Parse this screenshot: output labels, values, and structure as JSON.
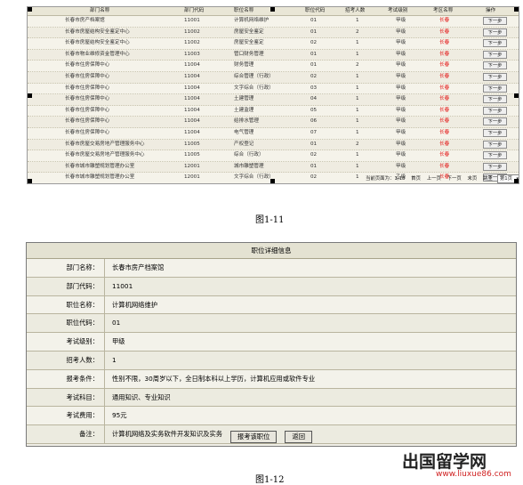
{
  "figure_1_11": {
    "caption": "图1-11",
    "headers": [
      "部门名称",
      "部门代码",
      "职位名称",
      "职位代码",
      "招考人数",
      "考试级别",
      "考区名称",
      "操作"
    ],
    "rows": [
      [
        "长春市房产档案馆",
        "11001",
        "计算机网络维护",
        "01",
        "1",
        "甲级",
        "长春",
        "下一步"
      ],
      [
        "长春市房屋结构安全鉴定中心",
        "11002",
        "房屋安全鉴定",
        "01",
        "2",
        "甲级",
        "长春",
        "下一步"
      ],
      [
        "长春市房屋结构安全鉴定中心",
        "11002",
        "房屋安全鉴定",
        "02",
        "1",
        "甲级",
        "长春",
        "下一步"
      ],
      [
        "长春市物业维修资金管理中心",
        "11003",
        "管口财务管理",
        "01",
        "1",
        "甲级",
        "长春",
        "下一步"
      ],
      [
        "长春市住房保障中心",
        "11004",
        "财务管理",
        "01",
        "2",
        "甲级",
        "长春",
        "下一步"
      ],
      [
        "长春市住房保障中心",
        "11004",
        "综合管理（行政）",
        "02",
        "1",
        "甲级",
        "长春",
        "下一步"
      ],
      [
        "长春市住房保障中心",
        "11004",
        "文字综合（行政）",
        "03",
        "1",
        "甲级",
        "长春",
        "下一步"
      ],
      [
        "长春市住房保障中心",
        "11004",
        "土建管理",
        "04",
        "1",
        "甲级",
        "长春",
        "下一步"
      ],
      [
        "长春市住房保障中心",
        "11004",
        "土建监理",
        "05",
        "1",
        "甲级",
        "长春",
        "下一步"
      ],
      [
        "长春市住房保障中心",
        "11004",
        "给排水管理",
        "06",
        "1",
        "甲级",
        "长春",
        "下一步"
      ],
      [
        "长春市住房保障中心",
        "11004",
        "电气管理",
        "07",
        "1",
        "甲级",
        "长春",
        "下一步"
      ],
      [
        "长春市房屋交易房地产管理服务中心",
        "11005",
        "产权登记",
        "01",
        "2",
        "甲级",
        "长春",
        "下一步"
      ],
      [
        "长春市房屋交易房地产管理服务中心",
        "11005",
        "综合（行政）",
        "02",
        "1",
        "甲级",
        "长春",
        "下一步"
      ],
      [
        "长春市城市雕塑规划管理办公室",
        "12001",
        "城市雕塑管理",
        "01",
        "1",
        "甲级",
        "长春",
        "下一步"
      ],
      [
        "长春市城市雕塑规划管理办公室",
        "12001",
        "文字综合（行政）",
        "02",
        "1",
        "乙级",
        "长春",
        "下一步"
      ]
    ],
    "pager": {
      "status": "当前页面为：1/18",
      "first": "首页",
      "prev": "上一页",
      "next": "下一页",
      "last": "末页",
      "goto": "跳至",
      "page_select": "第1页"
    }
  },
  "figure_1_12": {
    "caption": "图1-12",
    "title": "职位详细信息",
    "fields": [
      {
        "label": "部门名称：",
        "value": "长春市房产档案馆"
      },
      {
        "label": "部门代码：",
        "value": "11001"
      },
      {
        "label": "职位名称：",
        "value": "计算机网络维护"
      },
      {
        "label": "职位代码：",
        "value": "01"
      },
      {
        "label": "考试级别：",
        "value": "甲级"
      },
      {
        "label": "招考人数：",
        "value": "1"
      },
      {
        "label": "报考条件：",
        "value": "性别不限，30周岁以下，全日制本科以上学历，计算机应用或软件专业"
      },
      {
        "label": "考试科目：",
        "value": "通用知识、专业知识"
      },
      {
        "label": "考试费用：",
        "value": "95元"
      },
      {
        "label": "备注：",
        "value": "计算机网络及实务软件开发知识及实务"
      }
    ],
    "apply_button": "报考该职位",
    "back_button": "返回"
  },
  "watermark": {
    "main": "出国留学网",
    "sub": "www.liuxue86.com"
  },
  "colors": {
    "red_text": "#e21212",
    "header_bg": "#e9e6d6",
    "panel_bg": "#f0efe7"
  }
}
